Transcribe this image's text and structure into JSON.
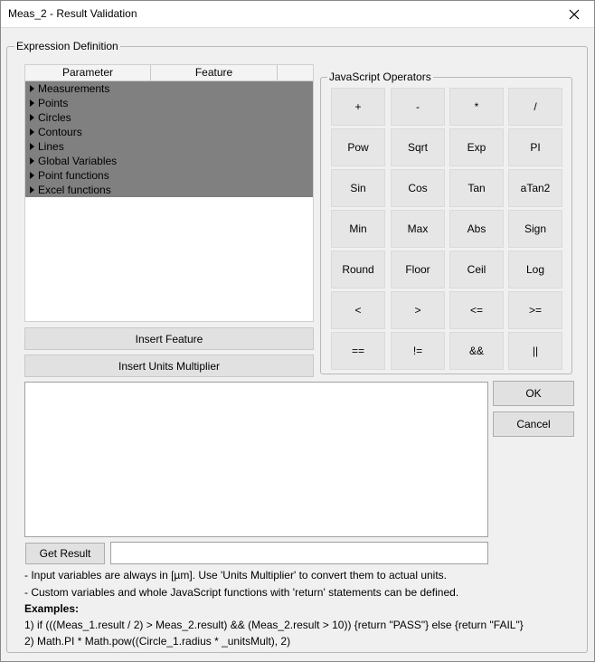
{
  "window": {
    "title": "Meas_2 - Result Validation"
  },
  "expression_group": {
    "label": "Expression Definition"
  },
  "tree": {
    "columns": [
      "Parameter",
      "Feature",
      ""
    ],
    "items": [
      "Measurements",
      "Points",
      "Circles",
      "Contours",
      "Lines",
      "Global Variables",
      "Point functions",
      "Excel functions"
    ]
  },
  "buttons": {
    "insert_feature": "Insert Feature",
    "insert_units": "Insert Units Multiplier",
    "ok": "OK",
    "cancel": "Cancel",
    "get_result": "Get Result"
  },
  "operators_group": {
    "label": "JavaScript Operators",
    "rows": [
      [
        "+",
        "-",
        "*",
        "/"
      ],
      [
        "Pow",
        "Sqrt",
        "Exp",
        "PI"
      ],
      [
        "Sin",
        "Cos",
        "Tan",
        "aTan2"
      ],
      [
        "Min",
        "Max",
        "Abs",
        "Sign"
      ],
      [
        "Round",
        "Floor",
        "Ceil",
        "Log"
      ],
      [
        "<",
        ">",
        "<=",
        ">="
      ],
      [
        "==",
        "!=",
        "&&",
        "||"
      ]
    ]
  },
  "notes": {
    "line1": "- Input variables are always in [µm]. Use 'Units Multiplier' to convert them to actual units.",
    "line2": "- Custom variables and whole JavaScript functions with 'return' statements can be defined.",
    "examples_label": "Examples:",
    "example1": "1) if (((Meas_1.result / 2) > Meas_2.result) && (Meas_2.result > 10)) {return \"PASS\"} else {return \"FAIL\"}",
    "example2": "2) Math.PI * Math.pow((Circle_1.radius * _unitsMult), 2)"
  },
  "icons": {
    "close": "close-icon",
    "expand": "triangle-right-icon"
  }
}
